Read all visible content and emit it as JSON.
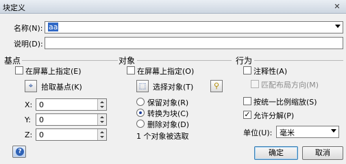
{
  "dialog": {
    "title": "块定义"
  },
  "name": {
    "label": "名称(N):",
    "value": "aa"
  },
  "description": {
    "label": "说明(D):",
    "value": ""
  },
  "base_point": {
    "title": "基点",
    "on_screen_label": "在屏幕上指定(E)",
    "on_screen_checked": false,
    "pick_label": "拾取基点(K)",
    "x_label": "X:",
    "x_value": "0",
    "y_label": "Y:",
    "y_value": "0",
    "z_label": "Z:",
    "z_value": "0"
  },
  "objects": {
    "title": "对象",
    "on_screen_label": "在屏幕上指定(O)",
    "on_screen_checked": false,
    "select_label": "选择对象(T)",
    "radio_retain": "保留对象(R)",
    "radio_convert": "转换为块(C)",
    "radio_delete": "删除对象(D)",
    "selected_radio": "convert",
    "status": "1 个对象被选取"
  },
  "behavior": {
    "title": "行为",
    "annotative_label": "注释性(A)",
    "annotative_checked": false,
    "match_orientation_label": "匹配布局方向(M)",
    "match_orientation_checked": false,
    "uniform_scale_label": "按统一比例缩放(S)",
    "uniform_scale_checked": false,
    "allow_explode_label": "允许分解(P)",
    "allow_explode_checked": true,
    "unit_label": "单位(U):",
    "unit_value": "毫米"
  },
  "buttons": {
    "ok": "确定",
    "cancel": "取消"
  },
  "icons": {
    "help": "help-icon",
    "pick_point": "pick-point-icon",
    "select_objects": "select-objects-icon",
    "quick_select": "quick-select-icon",
    "close": "close-icon"
  }
}
